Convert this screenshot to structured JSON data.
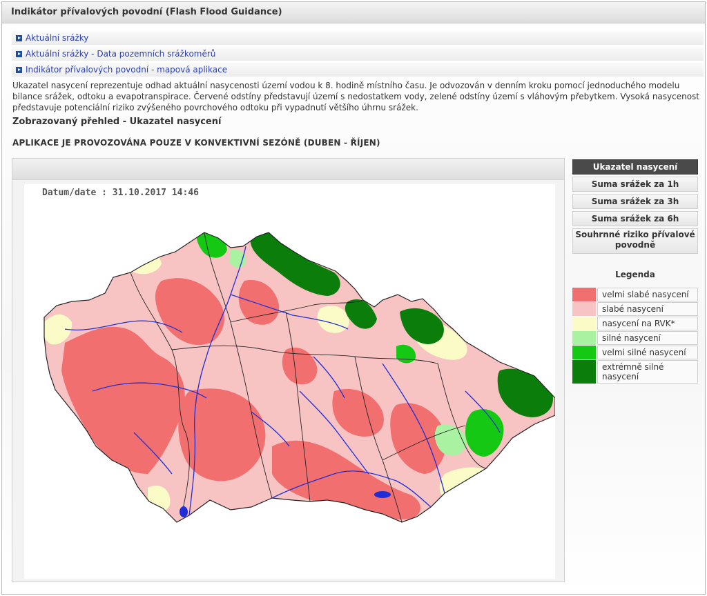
{
  "window": {
    "title": "Indikátor přívalových povodní (Flash Flood Guidance)"
  },
  "links": [
    {
      "label": "Aktuální srážky"
    },
    {
      "label": "Aktuální srážky - Data pozemních srážkoměrů"
    },
    {
      "label": "Indikátor přívalových povodní - mapová aplikace"
    }
  ],
  "description": "Ukazatel nasycení reprezentuje odhad aktuální nasycenosti území vodou k 8. hodině místního času. Je odvozován v denním kroku pomocí jednoduchého modelu bilance srážek, odtoku a evapotranspirace. Červené odstíny představují území s nedostatkem vody, zelené odstíny území s vláhovým přebytkem. Vysoká nasycenost představuje potenciální riziko zvýšeného povrchového odtoku při vypadnutí většího úhrnu srážek.",
  "subheading": "Zobrazovaný přehled - Ukazatel nasycení",
  "notice": "APLIKACE JE PROVOZOVÁNA POUZE V KONVEKTIVNÍ SEZÓNĚ (DUBEN - ŘÍJEN)",
  "map": {
    "datestamp": "Datum/date : 31.10.2017 14:46"
  },
  "tabs": [
    {
      "label": "Ukazatel nasycení",
      "active": true
    },
    {
      "label": "Suma srážek za 1h"
    },
    {
      "label": "Suma srážek za 3h"
    },
    {
      "label": "Suma srážek za 6h"
    },
    {
      "label": "Souhrnné riziko přívalové povodně"
    }
  ],
  "legend": {
    "title": "Legenda",
    "items": [
      {
        "label": "velmi slabé nasycení",
        "color": "#f26f6f"
      },
      {
        "label": "slabé nasycení",
        "color": "#f7c3c3"
      },
      {
        "label": "nasycení na RVK*",
        "color": "#fbfbc8"
      },
      {
        "label": "silné nasycení",
        "color": "#a9f2a2"
      },
      {
        "label": "velmi silné nasycení",
        "color": "#14c814"
      },
      {
        "label": "extrémně silné nasycení",
        "color": "#0a7d0a"
      }
    ]
  },
  "colors": {
    "river": "#1f2ed6",
    "border": "#222222"
  }
}
